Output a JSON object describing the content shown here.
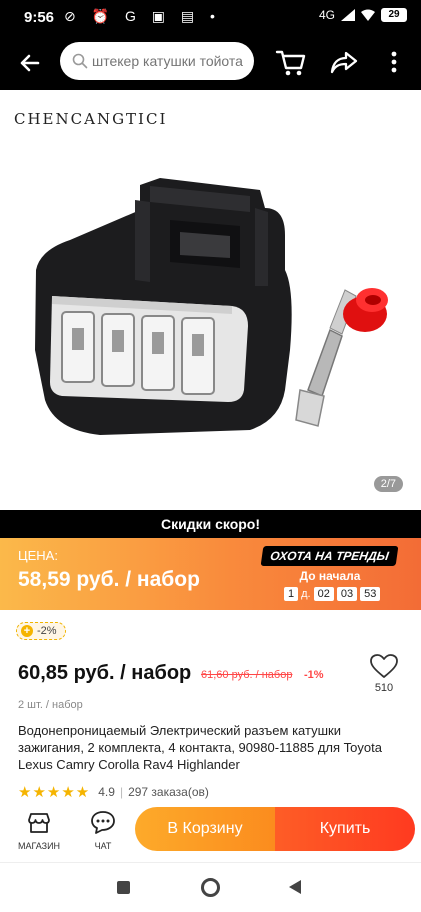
{
  "status_bar": {
    "time": "9:56",
    "left_icons": "⊘ ⏰ G ▣ ▤ •",
    "network": "4G",
    "battery": "29"
  },
  "top_nav": {
    "search_placeholder": "штекер катушки тойота"
  },
  "gallery": {
    "brand": "CHENCANGTICI",
    "counter": "2/7"
  },
  "sale": {
    "strip_text": "Скидки скоро!",
    "price_label": "ЦЕНА:",
    "sale_price": "58,59 руб. / набор",
    "badge": "ОХОТА НА ТРЕНДЫ",
    "until_label": "До начала",
    "timer": {
      "days": "1",
      "days_unit": "д.",
      "hours": "02",
      "minutes": "03",
      "seconds": "53"
    }
  },
  "coupon": {
    "text": "-2%"
  },
  "product": {
    "price": "60,85 руб. / набор",
    "old_price": "61,60 руб. / набор",
    "discount": "-1%",
    "unit": "2 шт. / набор",
    "wishlist_count": "510",
    "title": "Водонепроницаемый Электрический разъем катушки зажигания, 2 комплекта, 4 контакта, 90980-11885 для Toyota Lexus Camry Corolla Rav4 Highlander",
    "rating_stars": "★★★★★",
    "rating": "4.9",
    "orders": "297 заказа(ов)"
  },
  "actions": {
    "store_label": "МАГАЗИН",
    "chat_label": "ЧАТ",
    "cart_label": "В Корзину",
    "buy_label": "Купить"
  },
  "colors": {
    "accent_orange": "#fb8c1e",
    "buy_red": "#ff3a20",
    "price_red": "#ff4747",
    "star": "#f5b400"
  }
}
